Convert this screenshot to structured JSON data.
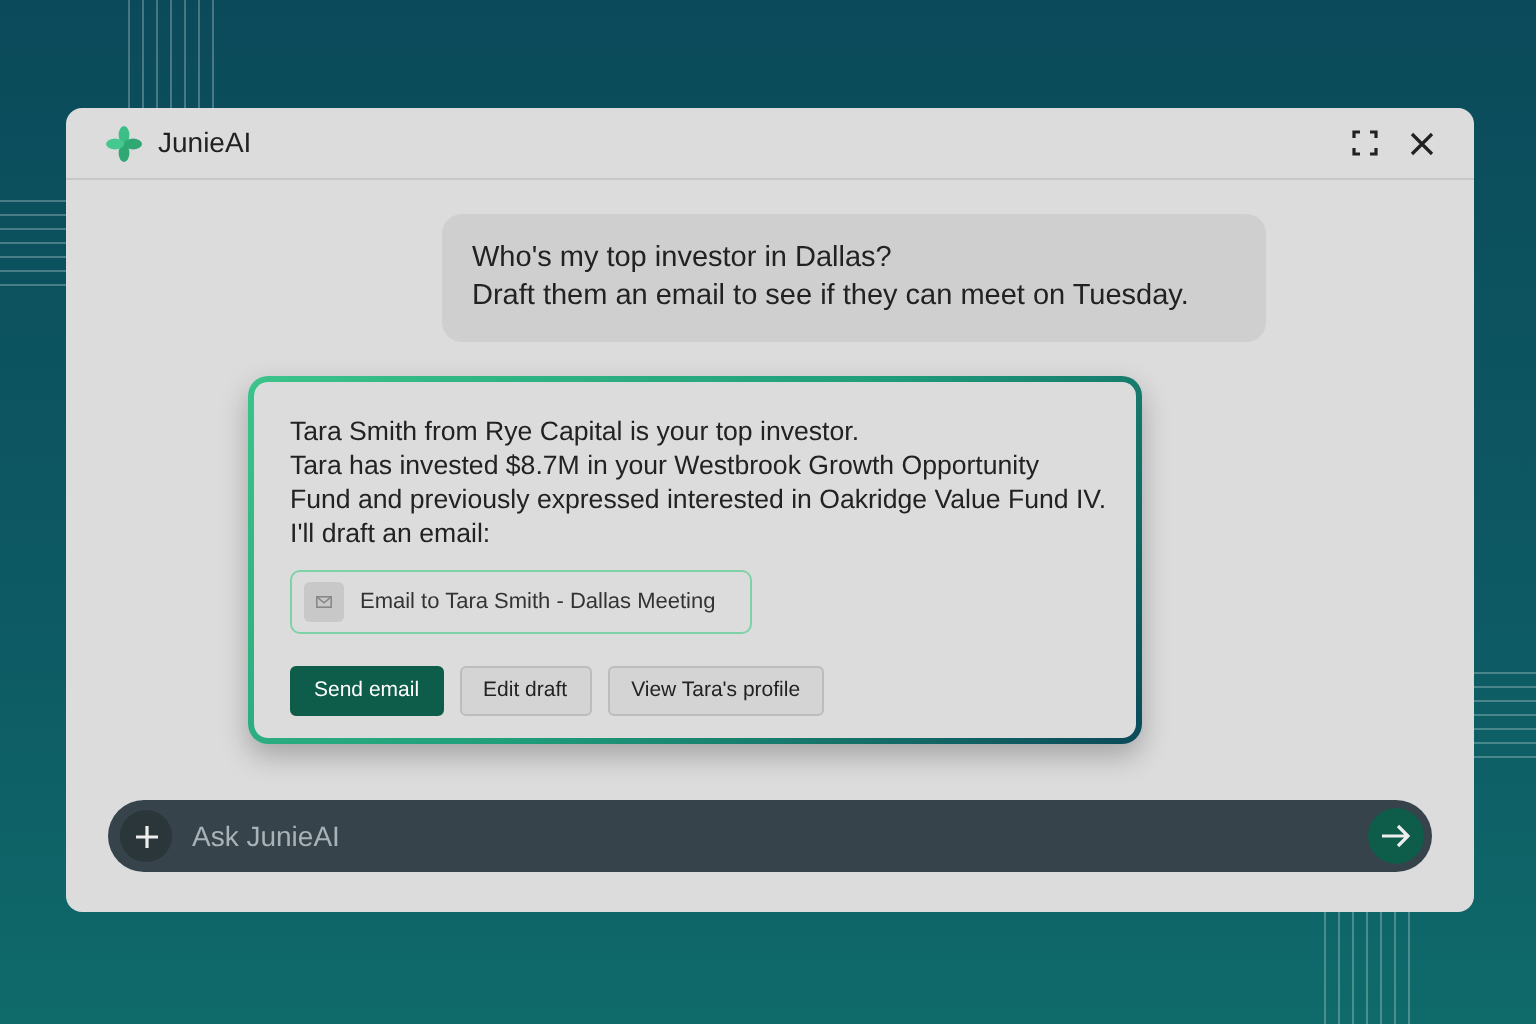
{
  "window": {
    "app_name": "JunieAI"
  },
  "user_message": {
    "lines": [
      "Who's my top investor in Dallas?",
      "Draft them an email to see if they can meet on Tuesday."
    ]
  },
  "reply": {
    "lines": [
      "Tara Smith from Rye Capital is your top investor.",
      "Tara has invested $8.7M in your Westbrook Growth Opportunity",
      "Fund and previously expressed interested in Oakridge Value Fund IV.",
      "I'll draft an email:"
    ],
    "attachment": {
      "label": "Email to Tara Smith - Dallas Meeting"
    },
    "buttons": [
      {
        "label": "Send email",
        "kind": "primary"
      },
      {
        "label": "Edit draft",
        "kind": "secondary"
      },
      {
        "label": "View Tara's profile",
        "kind": "secondary"
      }
    ]
  },
  "composer": {
    "placeholder": "Ask JunieAI"
  }
}
